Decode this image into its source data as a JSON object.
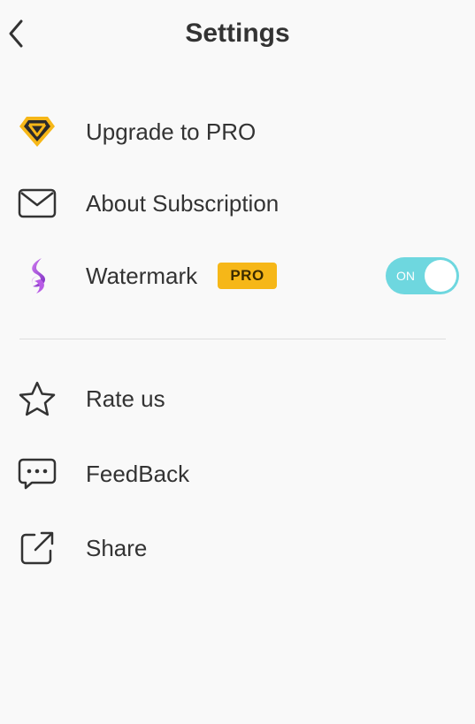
{
  "header": {
    "title": "Settings",
    "back_icon": "chevron-left-icon"
  },
  "menu": {
    "items": [
      {
        "label": "Upgrade to PRO",
        "icon": "diamond-icon"
      },
      {
        "label": "About Subscription",
        "icon": "mail-icon"
      },
      {
        "label": "Watermark",
        "icon": "watermark-logo-icon",
        "badge": "PRO",
        "toggle_label": "ON",
        "toggle_on": true
      },
      {
        "label": "Rate us",
        "icon": "star-icon"
      },
      {
        "label": "FeedBack",
        "icon": "chat-bubble-icon"
      },
      {
        "label": "Share",
        "icon": "share-icon"
      }
    ]
  },
  "colors": {
    "background": "#f9f9f9",
    "text": "#333333",
    "pro_badge": "#f6b718",
    "toggle_on": "#6ed7df",
    "diamond": "#f6b718",
    "watermark_logo": "#a44bd8"
  }
}
